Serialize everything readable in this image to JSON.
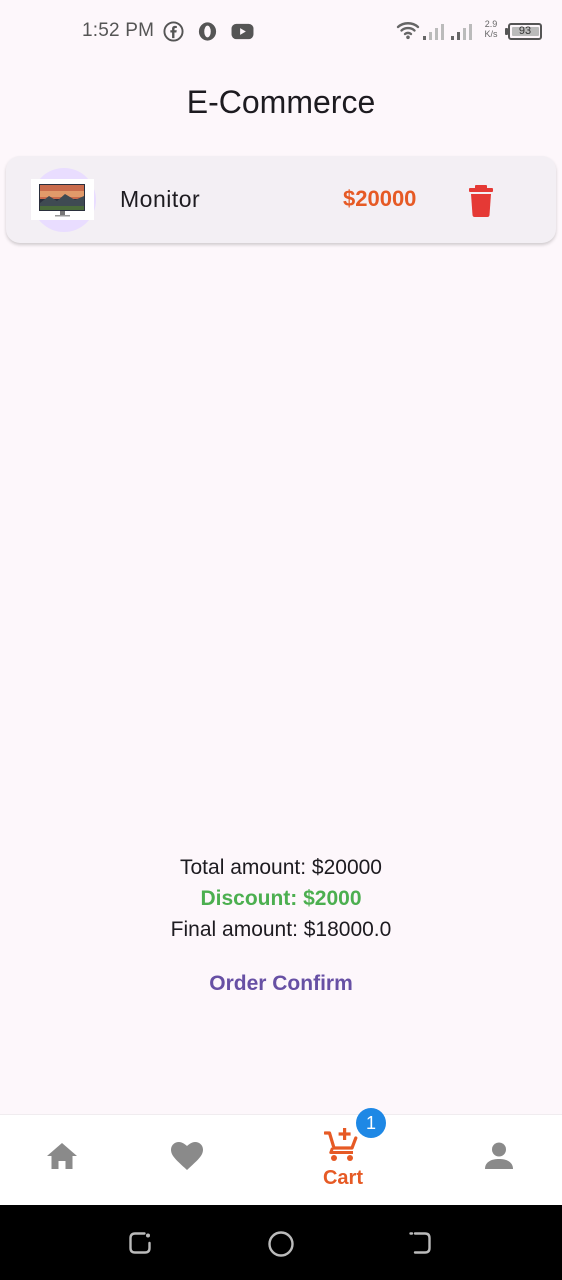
{
  "status_bar": {
    "time": "1:52 PM",
    "net_speed_value": "2.9",
    "net_speed_unit": "K/s",
    "battery": "93",
    "app_icons": [
      "facebook-icon",
      "opera-icon",
      "youtube-icon"
    ]
  },
  "header": {
    "title": "E-Commerce"
  },
  "cart": {
    "items": [
      {
        "name": "Monitor",
        "price": "$20000",
        "image": "monitor-thumbnail"
      }
    ]
  },
  "summary": {
    "total": "Total amount: $20000",
    "discount": "Discount: $2000",
    "final": "Final amount: $18000.0",
    "order_button": "Order Confirm"
  },
  "bottom_nav": {
    "items": [
      {
        "id": "home",
        "icon": "home-icon",
        "active": false
      },
      {
        "id": "favorites",
        "icon": "heart-icon",
        "active": false
      },
      {
        "id": "cart",
        "icon": "cart-add-icon",
        "label": "Cart",
        "badge": "1",
        "active": true
      },
      {
        "id": "profile",
        "icon": "person-icon",
        "active": false
      }
    ]
  },
  "colors": {
    "accent_orange": "#e65a25",
    "discount_green": "#4caf50",
    "button_purple": "#6750a4",
    "delete_red": "#e53935",
    "badge_blue": "#1e88e5",
    "inactive_icon": "#8a8a8a"
  }
}
